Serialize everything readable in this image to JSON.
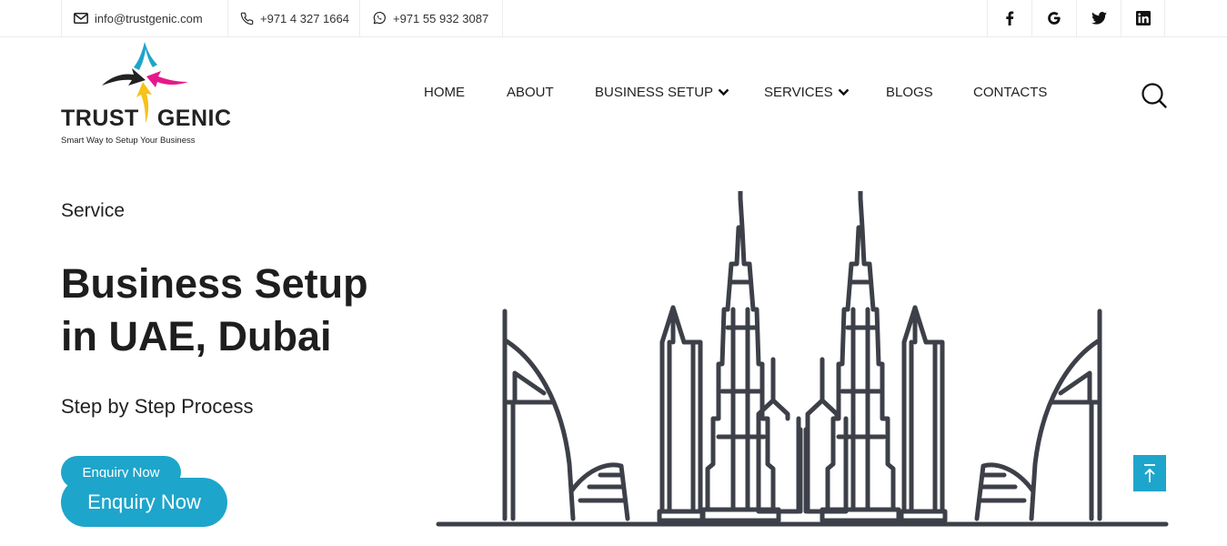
{
  "topbar": {
    "email": {
      "icon": "envelope-icon",
      "text": "info@trustgenic.com"
    },
    "phone": {
      "icon": "phone-icon",
      "text": "+971 4 327 1664"
    },
    "whatsapp": {
      "icon": "whatsapp-icon",
      "text": "+971 55 932 3087"
    },
    "socials": [
      "facebook-icon",
      "google-icon",
      "twitter-icon",
      "linkedin-icon"
    ]
  },
  "logo": {
    "word1": "TRUST",
    "word2": "GENIC",
    "tagline": "Smart Way to Setup Your Business",
    "colors": [
      "#1ea5cb",
      "#e6178a",
      "#f6c21a",
      "#222222"
    ]
  },
  "nav": {
    "items": [
      {
        "label": "HOME",
        "dropdown": false
      },
      {
        "label": "ABOUT",
        "dropdown": false
      },
      {
        "label": "BUSINESS SETUP",
        "dropdown": true
      },
      {
        "label": "SERVICES",
        "dropdown": true
      },
      {
        "label": "BLOGS",
        "dropdown": false
      },
      {
        "label": "CONTACTS",
        "dropdown": false
      }
    ],
    "search_icon": "search-icon"
  },
  "hero": {
    "eyebrow": "Service",
    "title_line1": "Business Setup",
    "title_line2": "in UAE, Dubai",
    "subtitle": "Step by Step Process",
    "button_small": "Enquiry Now",
    "button_large": "Enquiry Now",
    "illustration": "dubai-skyline-illustration"
  },
  "scroll_top": {
    "icon": "arrow-up-icon"
  },
  "colors": {
    "accent": "#1ea5cb",
    "text": "#222222",
    "line_art": "#3d4048"
  }
}
